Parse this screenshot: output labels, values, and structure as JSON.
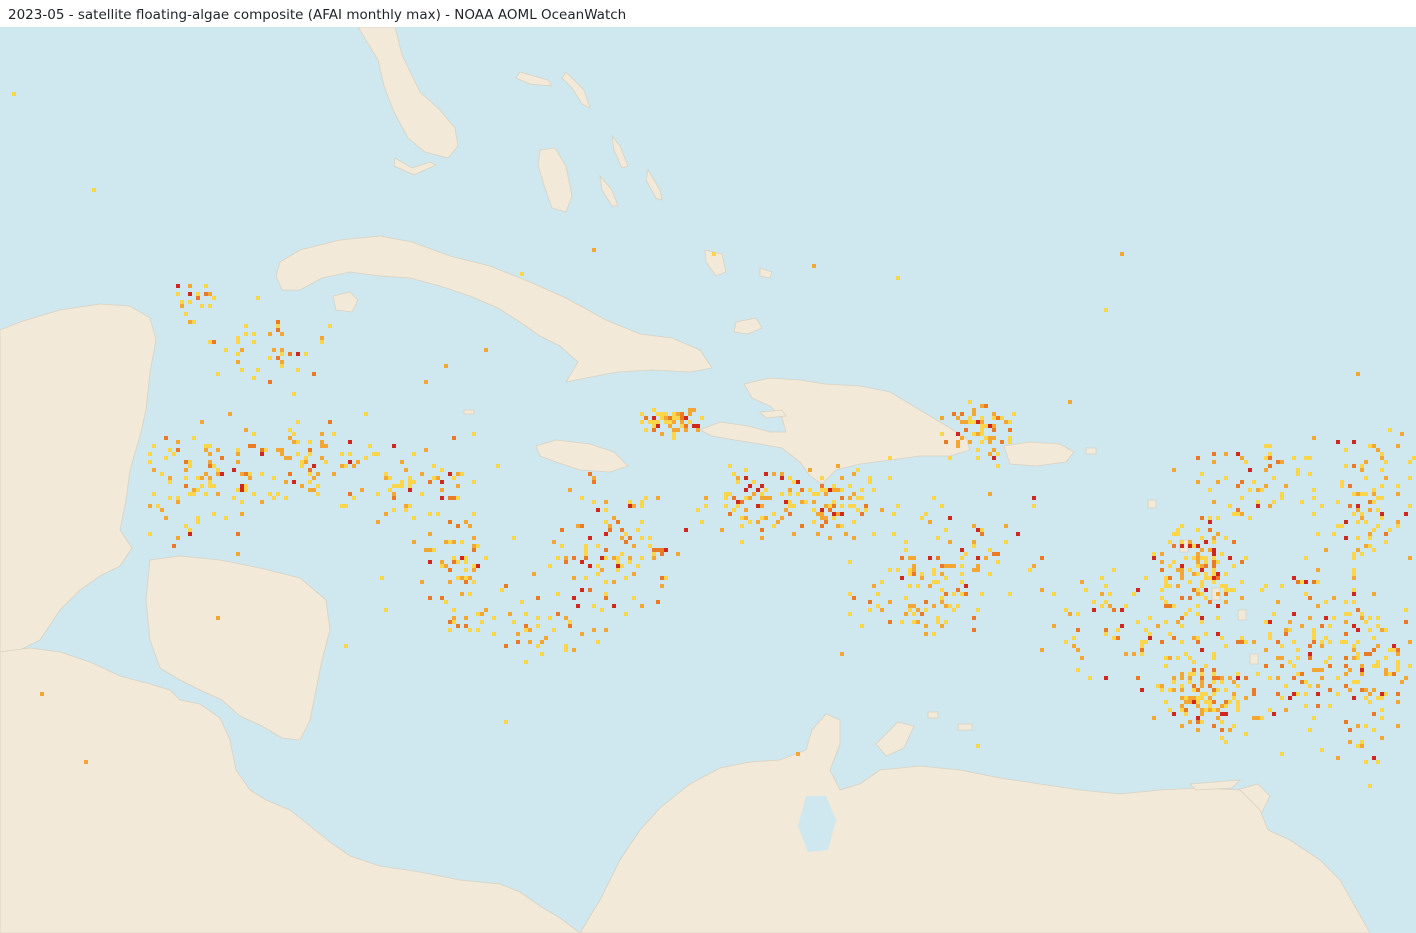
{
  "title": "2023-05 - satellite floating-algae composite (AFAI monthly max) - NOAA AOML OceanWatch",
  "colors": {
    "ocean": "#cfe7ee",
    "land": "#f2e9d8",
    "coast": "#d9d2c2",
    "algae_low": "#fbd54a",
    "algae_mid": "#f3a632",
    "algae_high": "#ea7a25",
    "algae_max": "#d0281e"
  }
}
